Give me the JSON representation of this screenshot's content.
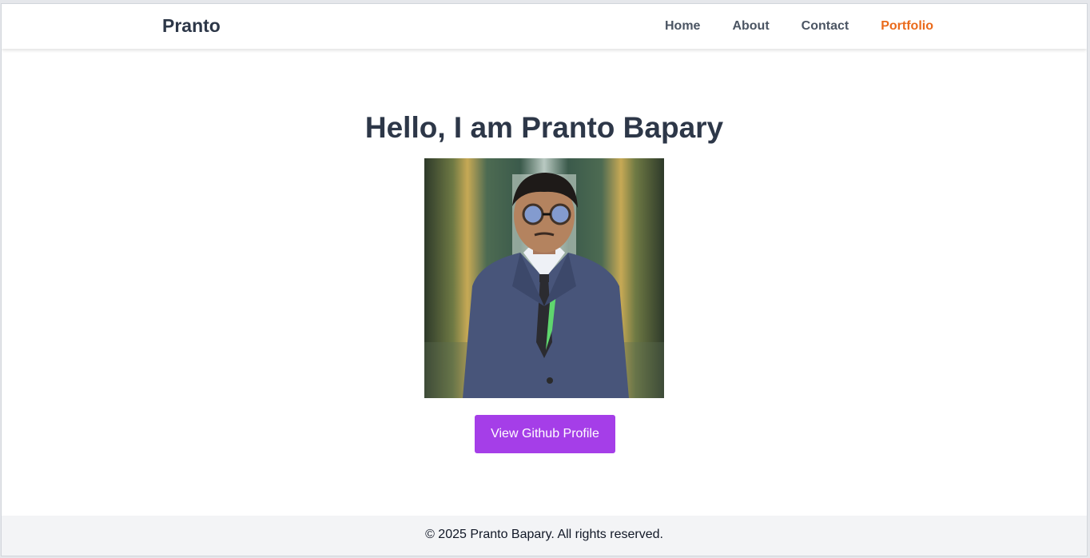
{
  "navbar": {
    "brand": "Pranto",
    "links": [
      {
        "label": "Home"
      },
      {
        "label": "About"
      },
      {
        "label": "Contact"
      },
      {
        "label": "Portfolio",
        "active": true
      }
    ]
  },
  "hero": {
    "title": "Hello, I am Pranto Bapary",
    "photo_alt": "Portrait of Pranto Bapary",
    "button_label": "View Github Profile"
  },
  "footer": {
    "text": "© 2025 Pranto Bapary. All rights reserved."
  },
  "colors": {
    "accent_nav": "#ea6a1b",
    "button": "#a53ee8",
    "heading": "#2d3748"
  }
}
